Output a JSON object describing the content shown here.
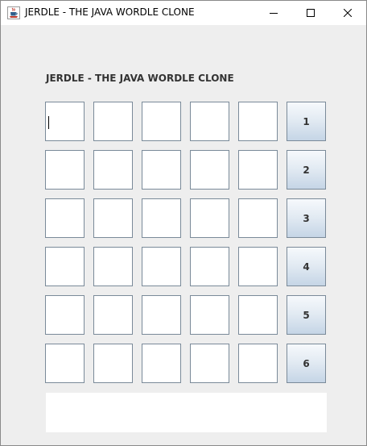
{
  "window": {
    "title": "JERDLE - THE JAVA WORDLE CLONE",
    "icon": "java-cup-icon"
  },
  "heading": "JERDLE - THE JAVA WORDLE CLONE",
  "rows": [
    {
      "cells": [
        "",
        "",
        "",
        "",
        ""
      ],
      "button_label": "1"
    },
    {
      "cells": [
        "",
        "",
        "",
        "",
        ""
      ],
      "button_label": "2"
    },
    {
      "cells": [
        "",
        "",
        "",
        "",
        ""
      ],
      "button_label": "3"
    },
    {
      "cells": [
        "",
        "",
        "",
        "",
        ""
      ],
      "button_label": "4"
    },
    {
      "cells": [
        "",
        "",
        "",
        "",
        ""
      ],
      "button_label": "5"
    },
    {
      "cells": [
        "",
        "",
        "",
        "",
        ""
      ],
      "button_label": "6"
    }
  ],
  "status_message": ""
}
